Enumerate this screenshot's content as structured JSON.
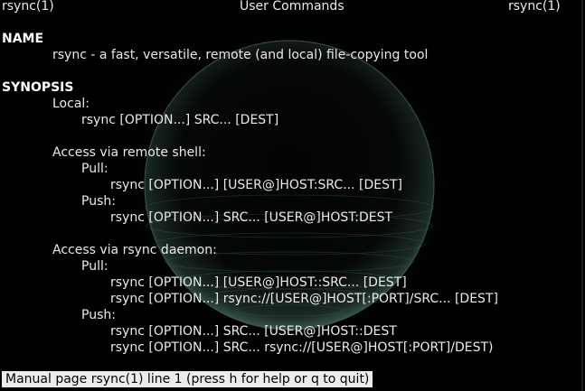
{
  "header": {
    "left": "rsync(1)",
    "center": "User Commands",
    "right": "rsync(1)"
  },
  "sections": {
    "name_heading": "NAME",
    "name_text": "rsync - a fast, versatile, remote (and local) file-copying tool",
    "synopsis_heading": "SYNOPSIS"
  },
  "synopsis": {
    "local_label": "Local:",
    "local_cmd": "rsync [OPTION...] SRC... [DEST]",
    "remote_shell_label": "Access via remote shell:",
    "remote_shell_pull_label": "Pull:",
    "remote_shell_pull_cmd": "rsync [OPTION...] [USER@]HOST:SRC... [DEST]",
    "remote_shell_push_label": "Push:",
    "remote_shell_push_cmd": "rsync [OPTION...] SRC... [USER@]HOST:DEST",
    "daemon_label": "Access via rsync daemon:",
    "daemon_pull_label": "Pull:",
    "daemon_pull_cmd_1": "rsync [OPTION...] [USER@]HOST::SRC... [DEST]",
    "daemon_pull_cmd_2": "rsync [OPTION...] rsync://[USER@]HOST[:PORT]/SRC... [DEST]",
    "daemon_push_label": "Push:",
    "daemon_push_cmd_1": "rsync [OPTION...] SRC... [USER@]HOST::DEST",
    "daemon_push_cmd_2": "rsync [OPTION...] SRC... rsync://[USER@]HOST[:PORT]/DEST)"
  },
  "status_bar": {
    "text": "Manual page rsync(1) line 1 (press h for help or q to quit)"
  },
  "colors": {
    "background": "#000000",
    "text": "#eaeaea",
    "status_bg": "#ececec",
    "sphere_glow": "#2a4a40"
  }
}
